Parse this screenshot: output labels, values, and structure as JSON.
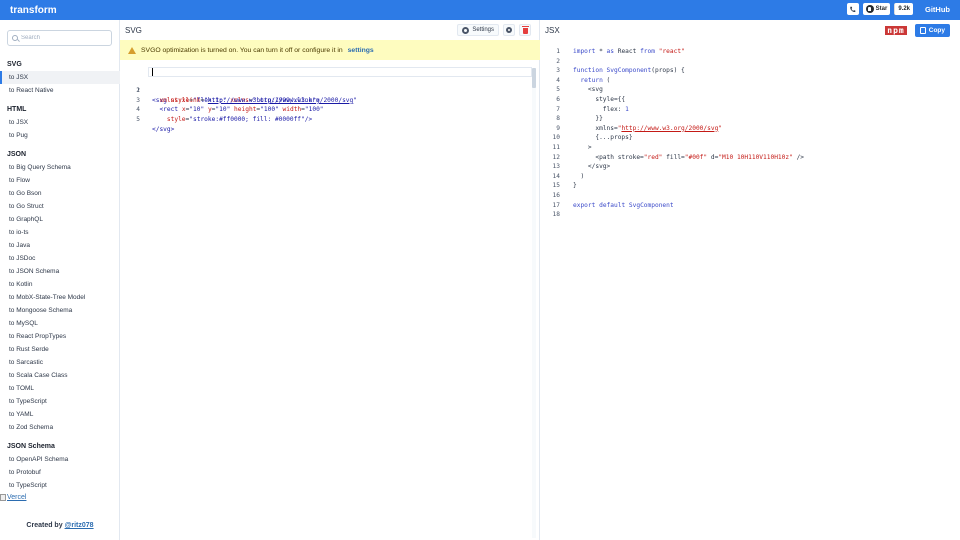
{
  "app": {
    "brand": "transform",
    "github_label": "GitHub",
    "star_label": "Star",
    "star_count": "9.2k"
  },
  "search": {
    "placeholder": "Search"
  },
  "sidebar": {
    "groups": [
      {
        "title": "SVG",
        "items": [
          "to JSX",
          "to React Native"
        ]
      },
      {
        "title": "HTML",
        "items": [
          "to JSX",
          "to Pug"
        ]
      },
      {
        "title": "JSON",
        "items": [
          "to Big Query Schema",
          "to Flow",
          "to Go Bson",
          "to Go Struct",
          "to GraphQL",
          "to io-ts",
          "to Java",
          "to JSDoc",
          "to JSON Schema",
          "to Kotlin",
          "to MobX-State-Tree Model",
          "to Mongoose Schema",
          "to MySQL",
          "to React PropTypes",
          "to Rust Serde",
          "to Sarcastic",
          "to Scala Case Class",
          "to TOML",
          "to TypeScript",
          "to YAML",
          "to Zod Schema"
        ]
      },
      {
        "title": "JSON Schema",
        "items": [
          "to OpenAPI Schema",
          "to Protobuf",
          "to TypeScript"
        ]
      }
    ],
    "active_item": "to JSX",
    "vercel_alt": "Vercel",
    "created_by": "Created by",
    "created_by_user": "@ritz078"
  },
  "svg_pane": {
    "title": "SVG",
    "settings_label": "Settings",
    "alert_text": "SVGO optimization is turned on. You can turn it off or configure it in",
    "alert_link": "settings",
    "line_numbers": [
      "1",
      "2",
      "3",
      "4",
      "5"
    ]
  },
  "jsx_pane": {
    "title": "JSX",
    "npm_label": "npm",
    "copy_label": "Copy",
    "line_numbers": [
      "1",
      "2",
      "3",
      "4",
      "5",
      "6",
      "7",
      "8",
      "9",
      "10",
      "11",
      "12",
      "13",
      "14",
      "15",
      "16",
      "17",
      "18"
    ]
  },
  "colors": {
    "topbar": "#2d7be6",
    "alert_bg": "#fefcbf",
    "npm_red": "#cb3837",
    "delete_red": "#e53e3e"
  }
}
